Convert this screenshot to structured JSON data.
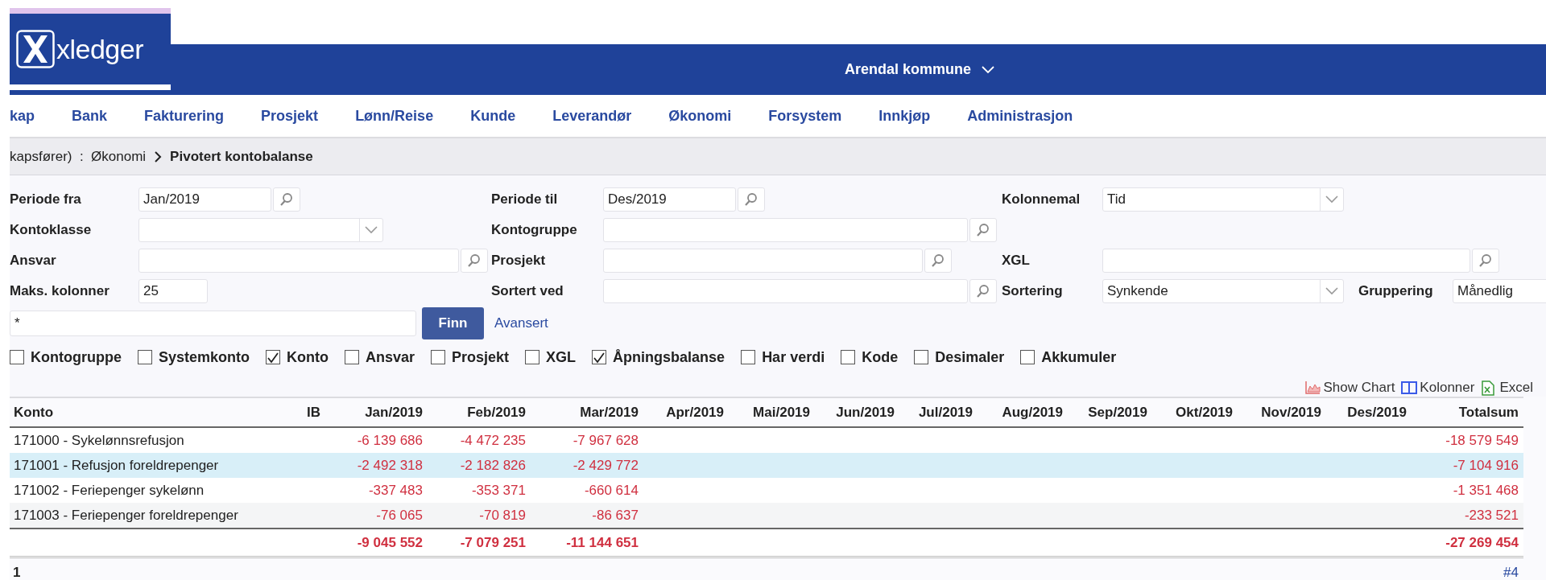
{
  "logo": {
    "text": "xledger"
  },
  "header": {
    "company": "Arendal kommune"
  },
  "nav": [
    "kap",
    "Bank",
    "Fakturering",
    "Prosjekt",
    "Lønn/Reise",
    "Kunde",
    "Leverandør",
    "Økonomi",
    "Forsystem",
    "Innkjøp",
    "Administrasjon"
  ],
  "breadcrumb": {
    "path": "kapsfører)  :  Økonomi",
    "current": "Pivotert kontobalanse"
  },
  "filters": [
    {
      "label": "Periode fra",
      "kind": "lookup",
      "value": "Jan/2019"
    },
    {
      "label": "Periode til",
      "kind": "lookup",
      "value": "Des/2019"
    },
    {
      "label": "Kolonnemal",
      "kind": "select",
      "value": "Tid"
    },
    {
      "label": "Kontoklasse",
      "kind": "select"
    },
    {
      "label": "Kontogruppe",
      "kind": "lookup"
    },
    {
      "label": "Ansvar",
      "kind": "lookup"
    },
    {
      "label": "Prosjekt",
      "kind": "lookup"
    },
    {
      "label": "XGL",
      "kind": "lookup"
    },
    {
      "label": "Maks. kolonner",
      "kind": "text",
      "value": "25"
    },
    {
      "label": "Sortert ved",
      "kind": "lookup"
    },
    {
      "label": "Sortering",
      "kind": "select",
      "value": "Synkende"
    },
    {
      "label": "Gruppering",
      "kind": "text",
      "value": "Månedlig"
    }
  ],
  "search": {
    "value": "*",
    "button": "Finn",
    "advanced": "Avansert"
  },
  "options": [
    {
      "label": "Kontogruppe",
      "checked": false
    },
    {
      "label": "Systemkonto",
      "checked": false
    },
    {
      "label": "Konto",
      "checked": true
    },
    {
      "label": "Ansvar",
      "checked": false
    },
    {
      "label": "Prosjekt",
      "checked": false
    },
    {
      "label": "XGL",
      "checked": false
    },
    {
      "label": "Åpningsbalanse",
      "checked": true
    },
    {
      "label": "Har verdi",
      "checked": false
    },
    {
      "label": "Kode",
      "checked": false
    },
    {
      "label": "Desimaler",
      "checked": false
    },
    {
      "label": "Akkumuler",
      "checked": false
    }
  ],
  "actions": [
    {
      "label": "Show Chart",
      "kind": "chart"
    },
    {
      "label": "Kolonner",
      "kind": "columns"
    },
    {
      "label": "Excel",
      "kind": "excel"
    }
  ],
  "table": {
    "columns": [
      "Konto",
      "IB",
      "Jan/2019",
      "Feb/2019",
      "Mar/2019",
      "Apr/2019",
      "Mai/2019",
      "Jun/2019",
      "Jul/2019",
      "Aug/2019",
      "Sep/2019",
      "Okt/2019",
      "Nov/2019",
      "Des/2019",
      "Totalsum"
    ],
    "rows": [
      {
        "konto": "171000 - Sykelønnsrefusjon",
        "values": [
          "-6 139 686",
          "-4 472 235",
          "-7 967 628"
        ],
        "total": "-18 579 549",
        "selected": false
      },
      {
        "konto": "171001 - Refusjon foreldrepenger",
        "values": [
          "-2 492 318",
          "-2 182 826",
          "-2 429 772"
        ],
        "total": "-7 104 916",
        "selected": true
      },
      {
        "konto": "171002 - Feriepenger sykelønn",
        "values": [
          "-337 483",
          "-353 371",
          "-660 614"
        ],
        "total": "-1 351 468",
        "selected": false
      },
      {
        "konto": "171003 - Feriepenger foreldrepenger",
        "values": [
          "-76 065",
          "-70 819",
          "-86 637"
        ],
        "total": "-233 521",
        "selected": false
      }
    ],
    "totals": {
      "values": [
        "-9 045 552",
        "-7 079 251",
        "-11 144 651"
      ],
      "total": "-27 269 454"
    }
  },
  "footer": {
    "page": "1",
    "count": "#4"
  }
}
